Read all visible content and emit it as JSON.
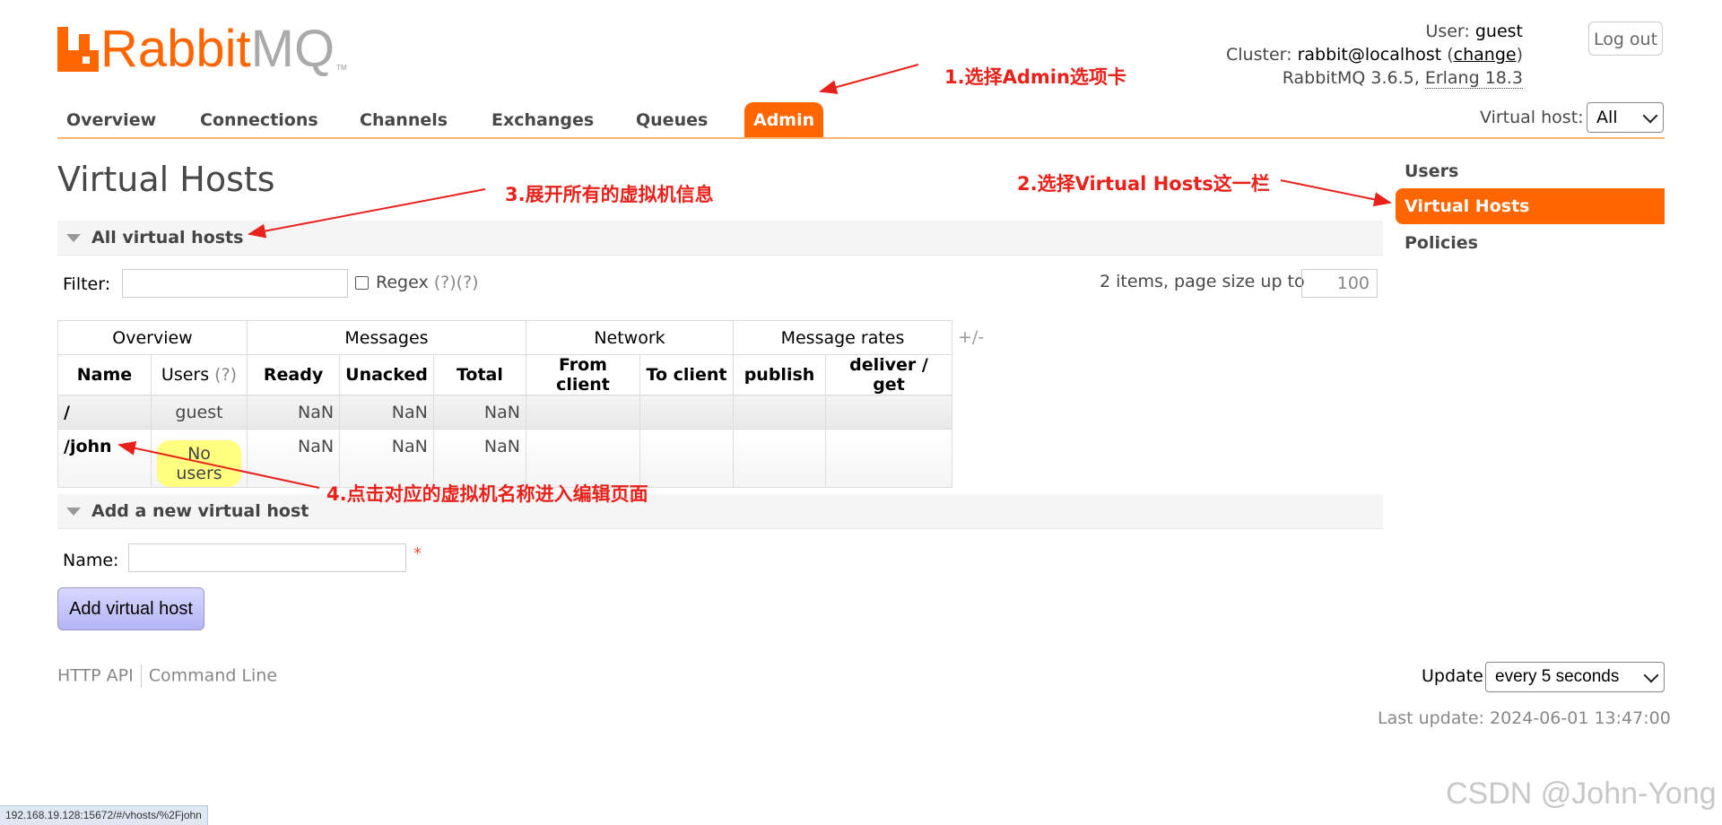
{
  "logo": {
    "word1": "Rabbit",
    "word2": "MQ",
    "tm": "TM"
  },
  "login": {
    "user_label": "User:",
    "user": "guest",
    "cluster_label": "Cluster:",
    "cluster": "rabbit@localhost",
    "change_open": "(",
    "change": "change",
    "change_close": ")",
    "version": "RabbitMQ 3.6.5,",
    "erlang": "Erlang 18.3",
    "logout": "Log out",
    "vhost_label": "Virtual host:",
    "vhost_value": "All"
  },
  "nav": {
    "tabs": [
      "Overview",
      "Connections",
      "Channels",
      "Exchanges",
      "Queues",
      "Admin"
    ],
    "active": "Admin"
  },
  "sidebar": {
    "items": [
      "Users",
      "Virtual Hosts",
      "Policies"
    ],
    "active": "Virtual Hosts"
  },
  "page": {
    "title": "Virtual Hosts"
  },
  "all_vhosts": {
    "header": "All virtual hosts",
    "filter_label": "Filter:",
    "regex_label": "Regex",
    "regex_help": "(?)(?)",
    "items_text": "2 items, page size up to",
    "page_size": "100",
    "plus_minus": "+/-",
    "groups": [
      "Overview",
      "Messages",
      "Network",
      "Message rates"
    ],
    "columns": [
      "Name",
      "Users",
      "Ready",
      "Unacked",
      "Total",
      "From client",
      "To client",
      "publish",
      "deliver / get"
    ],
    "users_help": "(?)",
    "rows": [
      {
        "name": "/",
        "users": "guest",
        "ready": "NaN",
        "unacked": "NaN",
        "total": "NaN"
      },
      {
        "name": "/john",
        "users": "No users",
        "ready": "NaN",
        "unacked": "NaN",
        "total": "NaN"
      }
    ]
  },
  "add_vhost": {
    "header": "Add a new virtual host",
    "name_label": "Name:",
    "required": "*",
    "button": "Add virtual host"
  },
  "footer": {
    "http_api": "HTTP API",
    "command_line": "Command Line",
    "update_label": "Update",
    "update_value": "every 5 seconds",
    "last_update": "Last update: 2024-06-01 13:47:00"
  },
  "annotations": {
    "a1": "1.选择Admin选项卡",
    "a2": "2.选择Virtual Hosts这一栏",
    "a3": "3.展开所有的虚拟机信息",
    "a4": "4.点击对应的虚拟机名称进入编辑页面"
  },
  "status_url": "192.168.19.128:15672/#/vhosts/%2Fjohn",
  "watermark": "CSDN @John-Yong",
  "colors": {
    "accent": "#ff6600",
    "annotation": "#e8211b",
    "highlight": "#ffff80"
  }
}
